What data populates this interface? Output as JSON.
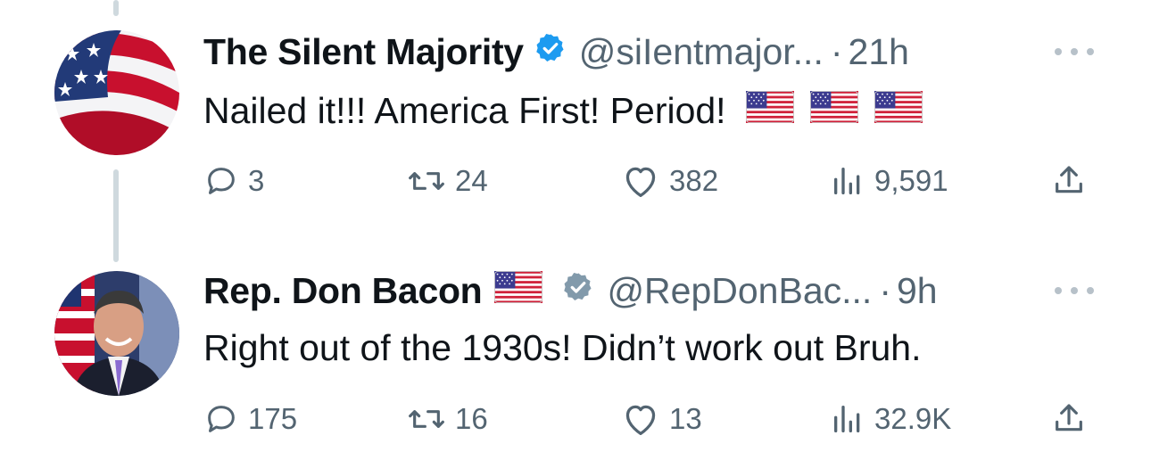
{
  "tweets": [
    {
      "display_name": "The Silent Majority",
      "verified": true,
      "verified_color": "#1d9bf0",
      "handle": "@siIentmajor...",
      "separator": "·",
      "time": "21h",
      "text": "Nailed it!!!  America First!  Period!",
      "text_emojis": [
        "us-flag-emoji",
        "us-flag-emoji",
        "us-flag-emoji"
      ],
      "actions": {
        "replies": "3",
        "retweets": "24",
        "likes": "382",
        "views": "9,591"
      }
    },
    {
      "display_name": "Rep. Don Bacon",
      "name_emoji": "us-flag-emoji",
      "verified": true,
      "verified_color": "#829aab",
      "handle": "@RepDonBac...",
      "separator": "·",
      "time": "9h",
      "text": "Right out of the 1930s! Didn’t work out Bruh.",
      "actions": {
        "replies": "175",
        "retweets": "16",
        "likes": "13",
        "views": "32.9K"
      }
    }
  ],
  "colors": {
    "text": "#0f1419",
    "secondary": "#536471",
    "thread_line": "#cfd9de"
  },
  "icons": [
    "reply-icon",
    "retweet-icon",
    "like-icon",
    "views-icon",
    "share-icon",
    "more-icon",
    "verified-badge-icon"
  ]
}
